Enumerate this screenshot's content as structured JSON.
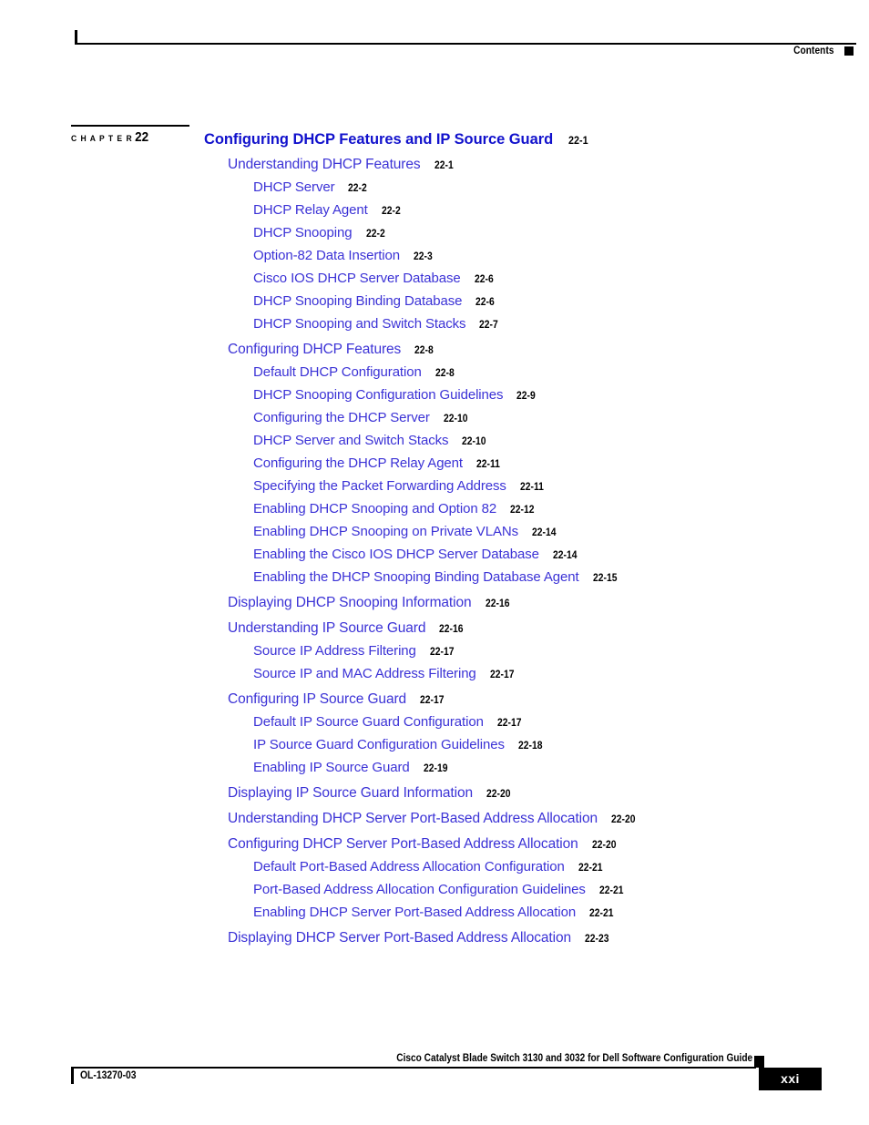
{
  "header": {
    "label": "Contents",
    "marker_icon": "black-square-marker"
  },
  "chapter": {
    "word": "C H A P T E R",
    "number": "22"
  },
  "colors": {
    "chapter_title": "#1111cc",
    "entry_link": "#3b32d6",
    "page_ref": "#000000",
    "rule": "#000000"
  },
  "toc": {
    "entries": [
      {
        "level": 0,
        "title": "Configuring DHCP Features and IP Source Guard",
        "page": "22-1",
        "gap": false
      },
      {
        "level": 1,
        "title": "Understanding DHCP Features",
        "page": "22-1",
        "gap": false
      },
      {
        "level": 2,
        "title": "DHCP Server",
        "page": "22-2",
        "gap": false
      },
      {
        "level": 2,
        "title": "DHCP Relay Agent",
        "page": "22-2",
        "gap": false
      },
      {
        "level": 2,
        "title": "DHCP Snooping",
        "page": "22-2",
        "gap": false
      },
      {
        "level": 2,
        "title": "Option-82 Data Insertion",
        "page": "22-3",
        "gap": false
      },
      {
        "level": 2,
        "title": "Cisco IOS DHCP Server Database",
        "page": "22-6",
        "gap": false
      },
      {
        "level": 2,
        "title": "DHCP Snooping Binding Database",
        "page": "22-6",
        "gap": false
      },
      {
        "level": 2,
        "title": "DHCP Snooping and Switch Stacks",
        "page": "22-7",
        "gap": false
      },
      {
        "level": 1,
        "title": "Configuring DHCP Features",
        "page": "22-8",
        "gap": true
      },
      {
        "level": 2,
        "title": "Default DHCP Configuration",
        "page": "22-8",
        "gap": false
      },
      {
        "level": 2,
        "title": "DHCP Snooping Configuration Guidelines",
        "page": "22-9",
        "gap": false
      },
      {
        "level": 2,
        "title": "Configuring the DHCP Server",
        "page": "22-10",
        "gap": false
      },
      {
        "level": 2,
        "title": "DHCP Server and Switch Stacks",
        "page": "22-10",
        "gap": false
      },
      {
        "level": 2,
        "title": "Configuring the DHCP Relay Agent",
        "page": "22-11",
        "gap": false
      },
      {
        "level": 2,
        "title": "Specifying the Packet Forwarding Address",
        "page": "22-11",
        "gap": false
      },
      {
        "level": 2,
        "title": "Enabling DHCP Snooping and Option 82",
        "page": "22-12",
        "gap": false
      },
      {
        "level": 2,
        "title": "Enabling DHCP Snooping on Private VLANs",
        "page": "22-14",
        "gap": false
      },
      {
        "level": 2,
        "title": "Enabling the Cisco IOS DHCP Server Database",
        "page": "22-14",
        "gap": false
      },
      {
        "level": 2,
        "title": "Enabling the DHCP Snooping Binding Database Agent",
        "page": "22-15",
        "gap": false
      },
      {
        "level": 1,
        "title": "Displaying DHCP Snooping Information",
        "page": "22-16",
        "gap": true
      },
      {
        "level": 1,
        "title": "Understanding IP Source Guard",
        "page": "22-16",
        "gap": true
      },
      {
        "level": 2,
        "title": "Source IP Address Filtering",
        "page": "22-17",
        "gap": false
      },
      {
        "level": 2,
        "title": "Source IP and MAC Address Filtering",
        "page": "22-17",
        "gap": false
      },
      {
        "level": 1,
        "title": "Configuring IP Source Guard",
        "page": "22-17",
        "gap": true
      },
      {
        "level": 2,
        "title": "Default IP Source Guard Configuration",
        "page": "22-17",
        "gap": false
      },
      {
        "level": 2,
        "title": "IP Source Guard Configuration Guidelines",
        "page": "22-18",
        "gap": false
      },
      {
        "level": 2,
        "title": "Enabling IP Source Guard",
        "page": "22-19",
        "gap": false
      },
      {
        "level": 1,
        "title": "Displaying IP Source Guard Information",
        "page": "22-20",
        "gap": true
      },
      {
        "level": 1,
        "title": "Understanding DHCP Server Port-Based Address Allocation",
        "page": "22-20",
        "gap": true
      },
      {
        "level": 1,
        "title": "Configuring DHCP Server Port-Based Address Allocation",
        "page": "22-20",
        "gap": true
      },
      {
        "level": 2,
        "title": "Default Port-Based Address Allocation Configuration",
        "page": "22-21",
        "gap": false
      },
      {
        "level": 2,
        "title": "Port-Based Address Allocation Configuration Guidelines",
        "page": "22-21",
        "gap": false
      },
      {
        "level": 2,
        "title": "Enabling DHCP Server Port-Based Address Allocation",
        "page": "22-21",
        "gap": false
      },
      {
        "level": 1,
        "title": "Displaying DHCP Server Port-Based Address Allocation",
        "page": "22-23",
        "gap": true
      }
    ]
  },
  "footer": {
    "guide_title": "Cisco Catalyst Blade Switch 3130 and 3032 for Dell Software Configuration Guide",
    "doc_id": "OL-13270-03",
    "page_number": "xxi"
  }
}
